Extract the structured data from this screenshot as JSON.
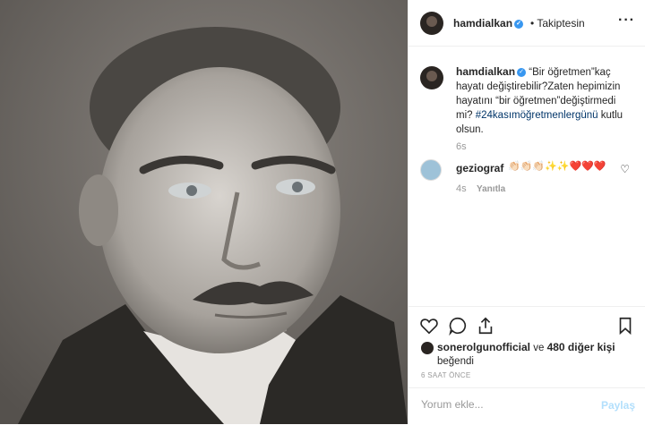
{
  "post": {
    "image_alt": "Black and white portrait photograph",
    "header": {
      "username": "hamdialkan",
      "follow_label": "Takiptesin",
      "more_icon": "ellipsis-icon"
    },
    "caption": {
      "username": "hamdialkan",
      "text": "“Bir öğretmen”kaç hayatı değiştirebilir?Zaten hepimizin hayatını “bir öğretmen”değiştirmedi mi? ",
      "hashtag": "#24kasımöğretmenlergünü",
      "text_after": " kutlu olsun.",
      "time": "6s"
    },
    "comments": [
      {
        "username": "geziograf",
        "text": "👏🏻👏🏻👏🏻✨✨❤️❤️❤️",
        "time": "4s",
        "reply_label": "Yanıtla"
      }
    ],
    "likes": {
      "user": "sonerolgunofficial",
      "connector": "ve",
      "others": "480 diğer kişi",
      "suffix": "beğendi"
    },
    "post_time": "6 SAAT ÖNCE",
    "comment_box": {
      "placeholder": "Yorum ekle...",
      "post_label": "Paylaş"
    }
  }
}
